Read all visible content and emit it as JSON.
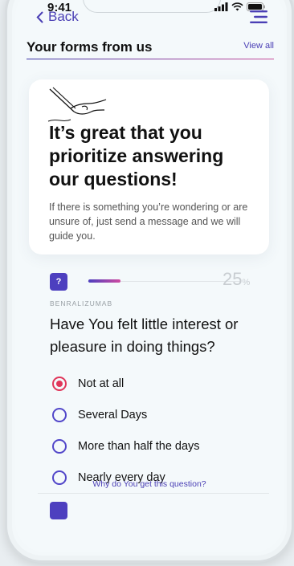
{
  "status": {
    "time": "9:41"
  },
  "nav": {
    "back_label": "Back"
  },
  "section": {
    "title": "Your forms from us",
    "view_all": "View all"
  },
  "card": {
    "title": "It’s great that you prioritize answering our questions!",
    "text": "If there is something you’re wondering or are unsure of, just send a message and we will guide you."
  },
  "progress": {
    "percent": "25",
    "unit": "%",
    "fraction": 0.25,
    "icon_glyph": "?"
  },
  "question": {
    "category": "BENRALIZUMAB",
    "text": "Have You felt little interest or pleasure in doing things?",
    "options": [
      {
        "label": "Not at all",
        "selected": true
      },
      {
        "label": "Several Days",
        "selected": false
      },
      {
        "label": "More than half the days",
        "selected": false
      },
      {
        "label": "Nearly every day",
        "selected": false
      }
    ],
    "why_link": "Why do You get this question?"
  },
  "colors": {
    "accent": "#4a3fb5",
    "selected": "#e0365a",
    "gradient_end": "#cf4aa0"
  }
}
